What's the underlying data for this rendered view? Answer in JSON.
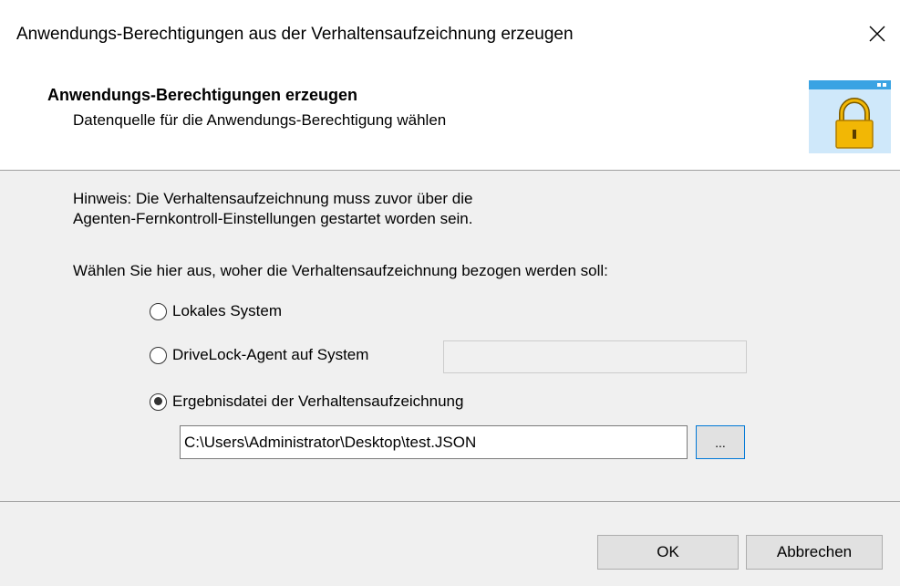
{
  "window": {
    "title": "Anwendungs-Berechtigungen aus der Verhaltensaufzeichnung erzeugen",
    "close_icon": "close-icon"
  },
  "header": {
    "title": "Anwendungs-Berechtigungen erzeugen",
    "subtitle": "Datenquelle für die Anwendungs-Berechtigung wählen",
    "icon": "padlock-window-icon",
    "icon_colors": {
      "window": "#cfe8fa",
      "titlebar": "#3aa3e3",
      "lock": "#f2b705"
    }
  },
  "content": {
    "hint_line1": "Hinweis: Die Verhaltensaufzeichnung muss zuvor über die",
    "hint_line2": "Agenten-Fernkontroll-Einstellungen gestartet worden sein.",
    "choose_label": "Wählen Sie hier aus, woher die Verhaltensaufzeichnung bezogen werden soll:",
    "options": [
      {
        "label": "Lokales System",
        "checked": false
      },
      {
        "label": "DriveLock-Agent auf System",
        "checked": false
      },
      {
        "label": "Ergebnisdatei der Verhaltensaufzeichnung",
        "checked": true
      }
    ],
    "agent_system_value": "",
    "file_path": "C:\\Users\\Administrator\\Desktop\\test.JSON",
    "browse_label": "..."
  },
  "footer": {
    "ok_label": "OK",
    "cancel_label": "Abbrechen"
  },
  "colors": {
    "content_bg": "#f0f0f0",
    "focus_border": "#0078d7",
    "button_bg": "#e1e1e1"
  }
}
